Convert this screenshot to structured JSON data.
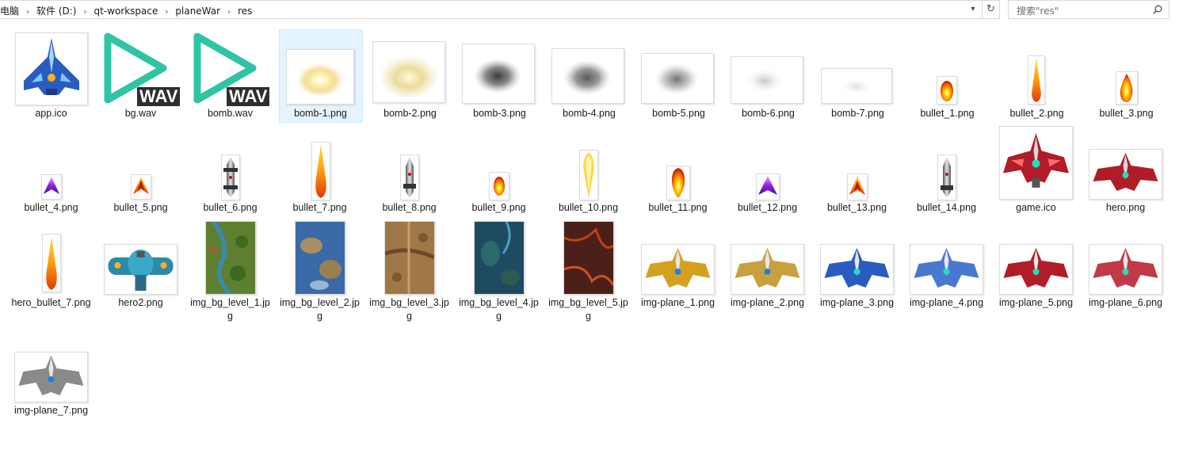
{
  "address_bar": {
    "crumbs": [
      "电脑",
      "软件 (D:)",
      "qt-workspace",
      "planeWar",
      "res"
    ]
  },
  "search": {
    "placeholder": "搜索\"res\""
  },
  "files": [
    {
      "name": "app.ico"
    },
    {
      "name": "bg.wav"
    },
    {
      "name": "bomb.wav"
    },
    {
      "name": "bomb-1.png"
    },
    {
      "name": "bomb-2.png"
    },
    {
      "name": "bomb-3.png"
    },
    {
      "name": "bomb-4.png"
    },
    {
      "name": "bomb-5.png"
    },
    {
      "name": "bomb-6.png"
    },
    {
      "name": "bomb-7.png"
    },
    {
      "name": "bullet_1.png"
    },
    {
      "name": "bullet_2.png"
    },
    {
      "name": "bullet_3.png"
    },
    {
      "name": "bullet_4.png"
    },
    {
      "name": "bullet_5.png"
    },
    {
      "name": "bullet_6.png"
    },
    {
      "name": "bullet_7.png"
    },
    {
      "name": "bullet_8.png"
    },
    {
      "name": "bullet_9.png"
    },
    {
      "name": "bullet_10.png"
    },
    {
      "name": "bullet_11.png"
    },
    {
      "name": "bullet_12.png"
    },
    {
      "name": "bullet_13.png"
    },
    {
      "name": "bullet_14.png"
    },
    {
      "name": "game.ico"
    },
    {
      "name": "hero.png"
    },
    {
      "name": "hero_bullet_7.png"
    },
    {
      "name": "hero2.png"
    },
    {
      "name": "img_bg_level_1.jpg"
    },
    {
      "name": "img_bg_level_2.jpg"
    },
    {
      "name": "img_bg_level_3.jpg"
    },
    {
      "name": "img_bg_level_4.jpg"
    },
    {
      "name": "img_bg_level_5.jpg"
    },
    {
      "name": "img-plane_1.png"
    },
    {
      "name": "img-plane_2.png"
    },
    {
      "name": "img-plane_3.png"
    },
    {
      "name": "img-plane_4.png"
    },
    {
      "name": "img-plane_5.png"
    },
    {
      "name": "img-plane_6.png"
    },
    {
      "name": "img-plane_7.png"
    }
  ],
  "wav_badge": "WAV",
  "colors": {
    "wav_accent": "#2ec4a4",
    "selection": "#e5f3ff",
    "plane_gold": "#d4a020",
    "plane_blue": "#2a5cc0",
    "plane_red": "#b01c28"
  }
}
